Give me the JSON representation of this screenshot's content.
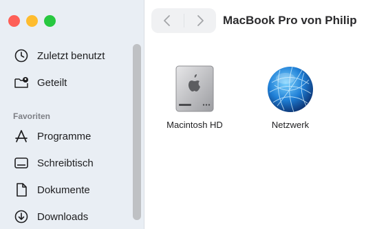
{
  "window": {
    "title": "MacBook Pro von Philip"
  },
  "sidebar": {
    "items": [
      {
        "label": "Zuletzt benutzt",
        "icon": "clock-icon"
      },
      {
        "label": "Geteilt",
        "icon": "shared-folder-icon"
      }
    ],
    "favorites_header": "Favoriten",
    "favorites": [
      {
        "label": "Programme",
        "icon": "applications-icon"
      },
      {
        "label": "Schreibtisch",
        "icon": "desktop-icon"
      },
      {
        "label": "Dokumente",
        "icon": "document-icon"
      },
      {
        "label": "Downloads",
        "icon": "download-icon"
      }
    ]
  },
  "main": {
    "items": [
      {
        "label": "Macintosh HD",
        "icon": "hard-drive-icon"
      },
      {
        "label": "Netzwerk",
        "icon": "network-globe-icon"
      }
    ]
  },
  "colors": {
    "close": "#fe5f57",
    "minimize": "#febc2e",
    "zoom": "#28c840",
    "sidebar_bg": "#e9eef4"
  }
}
